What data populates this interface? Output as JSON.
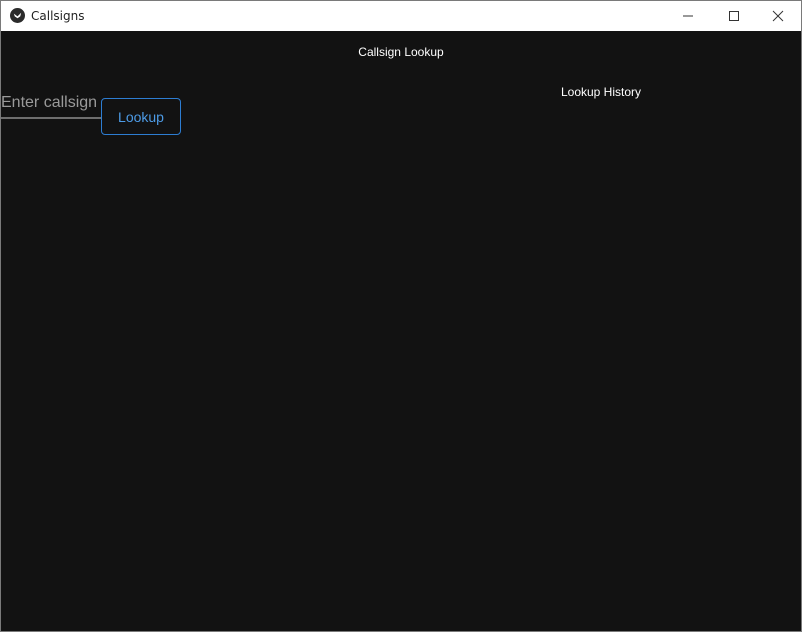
{
  "window": {
    "title": "Callsigns",
    "app_icon": "kivy-logo-icon",
    "controls": {
      "minimize_icon": "minimize-icon",
      "maximize_icon": "maximize-icon",
      "close_icon": "close-icon"
    }
  },
  "header": {
    "title": "Callsign Lookup"
  },
  "lookup": {
    "placeholder": "Enter callsign",
    "value": "",
    "button_label": "Lookup"
  },
  "history": {
    "title": "Lookup History",
    "items": []
  },
  "colors": {
    "background": "#121212",
    "accent": "#2d7dd2",
    "text": "#ffffff",
    "titlebar": "#ffffff"
  }
}
